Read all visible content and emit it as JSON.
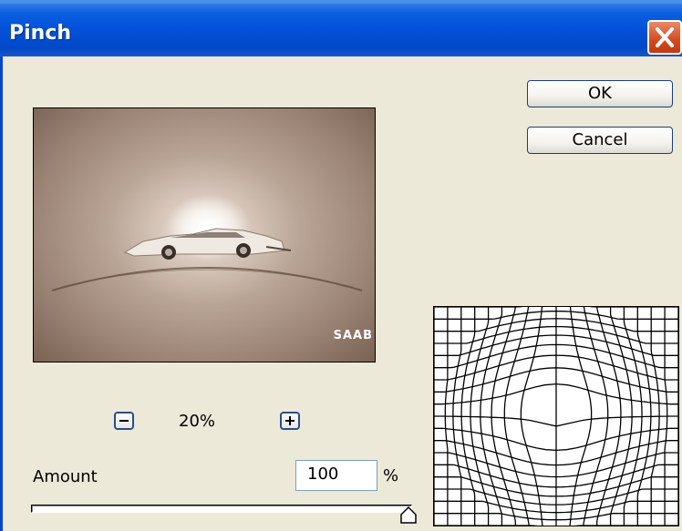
{
  "dialog": {
    "title": "Pinch",
    "close_icon": "close-icon",
    "title_color": "#0350d8",
    "close_color": "#d34a1f"
  },
  "buttons": {
    "ok_label": "OK",
    "cancel_label": "Cancel"
  },
  "preview": {
    "zoom_label": "20%",
    "zoom_out_icon": "minus-icon",
    "zoom_in_icon": "plus-icon",
    "logo_text": "SAAB"
  },
  "amount": {
    "label": "Amount",
    "value": "100",
    "unit": "%",
    "slider_fraction": 1.0
  },
  "grid_preview": {
    "icon": "distortion-grid-icon"
  }
}
